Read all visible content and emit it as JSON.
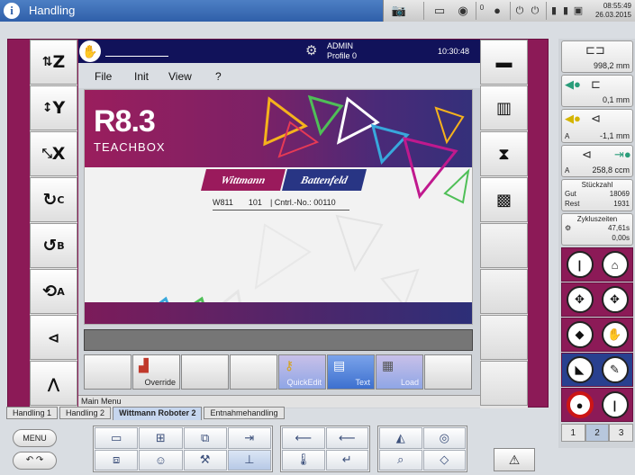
{
  "window": {
    "title": "Handling"
  },
  "tray": {
    "time": "08:55:49",
    "date": "26.03.2015",
    "counter": "0"
  },
  "header": {
    "user": "ADMIN",
    "profile": "Profile 0",
    "time": "10:30:48"
  },
  "menu": {
    "file": "File",
    "init": "Init",
    "view": "View",
    "help": "?"
  },
  "splash": {
    "version": "R8.3",
    "product": "TEACHBOX",
    "brand_left": "Wittmann",
    "brand_right": "Battenfeld",
    "controller": "W811",
    "number": "101",
    "separator": "|",
    "cntrl_no": "Cntrl.-No.: 00110"
  },
  "fkeys": [
    {
      "label": "",
      "icon": ""
    },
    {
      "label": "Override",
      "icon": "bar-chart-icon"
    },
    {
      "label": "",
      "icon": ""
    },
    {
      "label": "",
      "icon": ""
    },
    {
      "label": "QuickEdit",
      "icon": "key-icon"
    },
    {
      "label": "Text",
      "icon": "document-icon"
    },
    {
      "label": "Load",
      "icon": "disk-icon"
    },
    {
      "label": "",
      "icon": ""
    }
  ],
  "status": {
    "text": "Main Menu"
  },
  "tabs": [
    "Handling 1",
    "Handling 2",
    "Wittmann Roboter 2",
    "Entnahmehandling"
  ],
  "active_tab": "Wittmann Roboter 2",
  "left_axes": [
    {
      "main": "Z",
      "sub": ""
    },
    {
      "main": "Y",
      "sub": ""
    },
    {
      "main": "X",
      "sub": ""
    },
    {
      "main": "",
      "sub": "C"
    },
    {
      "main": "",
      "sub": "B"
    },
    {
      "main": "",
      "sub": "A"
    },
    {
      "main": "",
      "sub": ""
    },
    {
      "main": "",
      "sub": ""
    }
  ],
  "side": {
    "pos1": "998,2 mm",
    "pos2": "0,1 mm",
    "pos3": "-1,1 mm",
    "pos4": "258,8 ccm",
    "axis_a": "A",
    "stueckzahl_title": "Stückzahl",
    "gut_label": "Gut",
    "gut_value": "18069",
    "rest_label": "Rest",
    "rest_value": "1931",
    "zyklus_title": "Zykluszeiten",
    "zyklus_1": "47,61s",
    "zyklus_2": "0,00s",
    "badge": "2",
    "pages": [
      "1",
      "2",
      "3"
    ],
    "active_page": "2"
  },
  "bottom": {
    "menu_label": "MENU"
  },
  "colors": {
    "frame": "#8c1a57",
    "title_bar": "#2f5fa9",
    "header": "#11125a",
    "brand_blue": "#283584"
  }
}
